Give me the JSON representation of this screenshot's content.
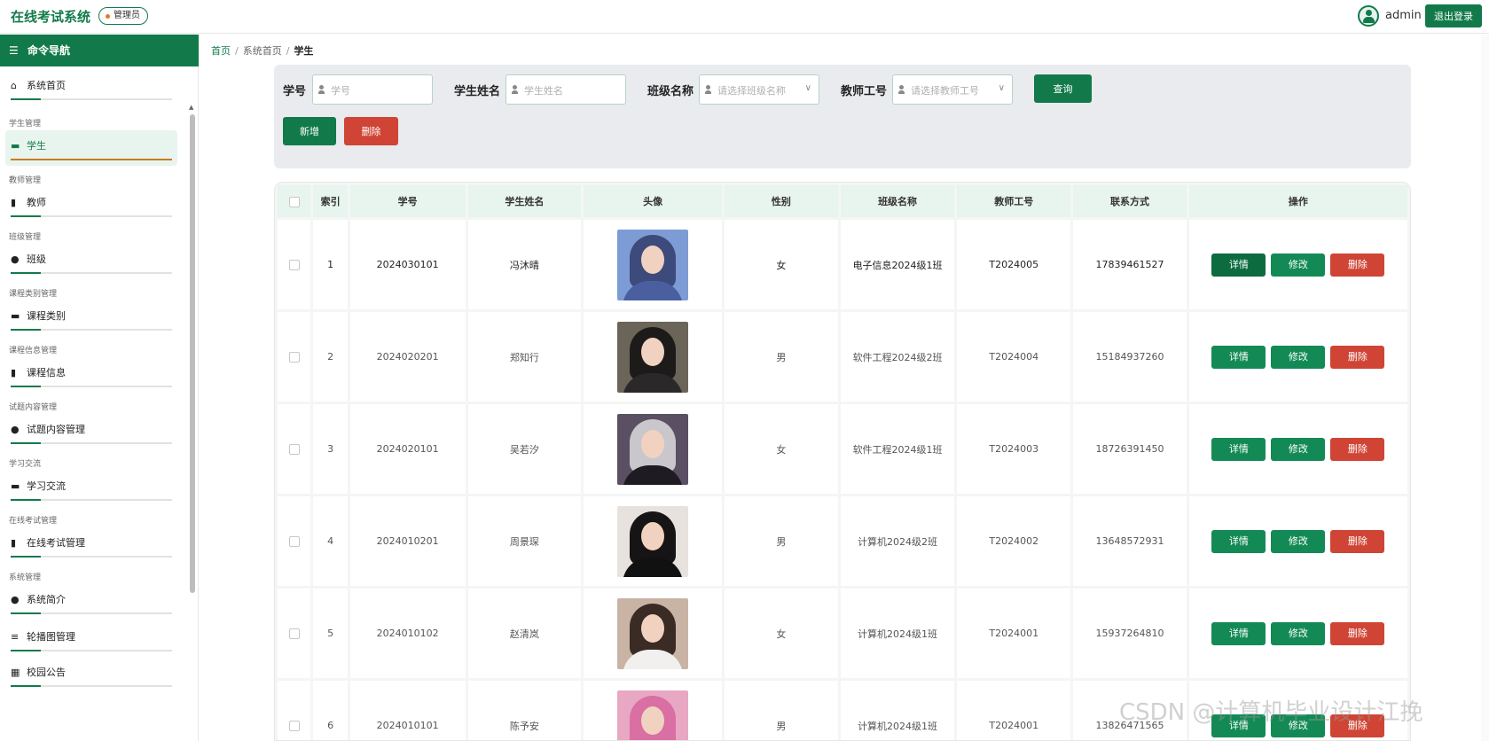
{
  "header": {
    "app_title": "在线考试系统",
    "role_badge": "管理员",
    "user_name": "admin",
    "logout_label": "退出登录"
  },
  "sidebar": {
    "title": "命令导航",
    "home": "系统首页",
    "groups": [
      {
        "title": "学生管理",
        "item": "学生",
        "icon": "briefcase-icon"
      },
      {
        "title": "教师管理",
        "item": "教师",
        "icon": "bar-chart-icon"
      },
      {
        "title": "班级管理",
        "item": "班级",
        "icon": "location-pin-icon"
      },
      {
        "title": "课程类别管理",
        "item": "课程类别",
        "icon": "briefcase-icon"
      },
      {
        "title": "课程信息管理",
        "item": "课程信息",
        "icon": "bar-chart-icon"
      },
      {
        "title": "试题内容管理",
        "item": "试题内容管理",
        "icon": "location-pin-icon"
      },
      {
        "title": "学习交流",
        "item": "学习交流",
        "icon": "briefcase-icon"
      },
      {
        "title": "在线考试管理",
        "item": "在线考试管理",
        "icon": "bar-chart-icon"
      },
      {
        "title": "系统管理",
        "item": "系统简介",
        "icon": "location-pin-icon"
      }
    ],
    "extra_items": [
      "轮播图管理",
      "校园公告"
    ],
    "active_item": "学生"
  },
  "breadcrumb": {
    "home": "首页",
    "level2": "系统首页",
    "current": "学生"
  },
  "search": {
    "label_id": "学号",
    "placeholder_id": "学号",
    "label_name": "学生姓名",
    "placeholder_name": "学生姓名",
    "label_class": "班级名称",
    "placeholder_class": "请选择班级名称",
    "label_teacher": "教师工号",
    "placeholder_teacher": "请选择教师工号",
    "query_label": "查询",
    "add_label": "新增",
    "delete_label": "删除"
  },
  "table": {
    "headers": [
      "索引",
      "学号",
      "学生姓名",
      "头像",
      "性别",
      "班级名称",
      "教师工号",
      "联系方式",
      "操作"
    ],
    "rows": [
      {
        "index": "1",
        "id": "2024030101",
        "name": "冯沐晴",
        "gender": "女",
        "class": "电子信息2024级1班",
        "teacher": "T2024005",
        "phone": "17839461527"
      },
      {
        "index": "2",
        "id": "2024020201",
        "name": "郑知行",
        "gender": "男",
        "class": "软件工程2024级2班",
        "teacher": "T2024004",
        "phone": "15184937260"
      },
      {
        "index": "3",
        "id": "2024020101",
        "name": "吴若汐",
        "gender": "女",
        "class": "软件工程2024级1班",
        "teacher": "T2024003",
        "phone": "18726391450"
      },
      {
        "index": "4",
        "id": "2024010201",
        "name": "周景琛",
        "gender": "男",
        "class": "计算机2024级2班",
        "teacher": "T2024002",
        "phone": "13648572931"
      },
      {
        "index": "5",
        "id": "2024010102",
        "name": "赵清岚",
        "gender": "女",
        "class": "计算机2024级1班",
        "teacher": "T2024001",
        "phone": "15937264810"
      },
      {
        "index": "6",
        "id": "2024010101",
        "name": "陈予安",
        "gender": "男",
        "class": "计算机2024级1班",
        "teacher": "T2024001",
        "phone": "13826471565"
      }
    ],
    "action_detail": "详情",
    "action_edit": "修改",
    "action_delete": "删除"
  },
  "watermark": "CSDN @计算机毕业设计江挽"
}
